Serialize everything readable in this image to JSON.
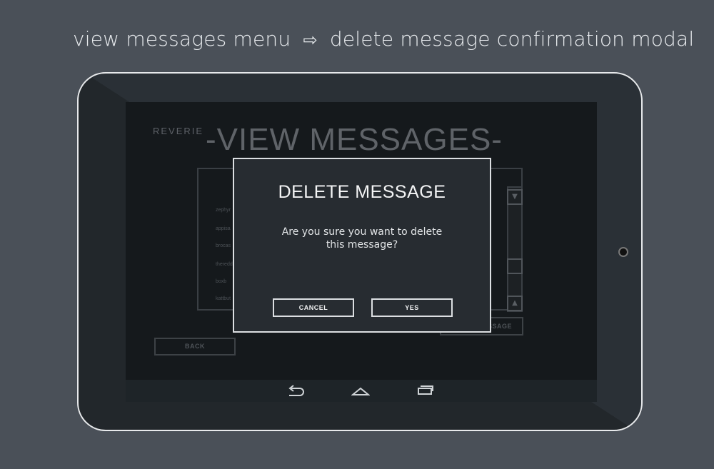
{
  "caption": {
    "from": "view messages menu",
    "arrow_icon": "arrow-right-icon",
    "to": "delete message confirmation modal"
  },
  "app": {
    "brand": "REVERIE",
    "title": "-VIEW MESSAGES-"
  },
  "messages": {
    "items": [
      "zephyr",
      "appisa",
      "brocas",
      "theredd",
      "boxb",
      "kattbut"
    ]
  },
  "buttons": {
    "back": "BACK",
    "delete_message_partial": "SSAGE"
  },
  "navbar": {
    "icons": [
      "back-icon",
      "home-icon",
      "recent-apps-icon"
    ]
  },
  "modal": {
    "title": "DELETE MESSAGE",
    "body": "Are you sure you want to delete this message?",
    "cancel": "CANCEL",
    "yes": "YES"
  }
}
